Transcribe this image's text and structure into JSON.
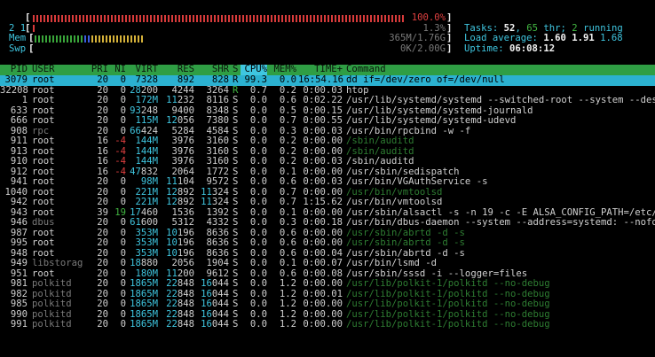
{
  "meters": {
    "cpu1": {
      "label": "1",
      "value": "100.0%",
      "fill": 1.0
    },
    "cpu2": {
      "label": "2",
      "value": "1.3%",
      "fill": 0.013
    },
    "mem": {
      "label": "Mem",
      "value": "365M/1.76G",
      "fill": 0.2
    },
    "swp": {
      "label": "Swp",
      "value": "0K/2.00G",
      "fill": 0.0
    }
  },
  "summary": {
    "tasks_label": "Tasks:",
    "tasks": "52",
    "sep": ",",
    "thr": "65",
    "thr_label": "thr;",
    "running": "2",
    "running_label": "running",
    "load_label": "Load average:",
    "load1": "1.60",
    "load5": "1.91",
    "load15": "1.68",
    "uptime_label": "Uptime:",
    "uptime": "06:08:12"
  },
  "columns": [
    "PID",
    "USER",
    "PRI",
    "NI",
    "VIRT",
    "RES",
    "SHR",
    "S",
    "CPU%",
    "MEM%",
    "TIME+",
    "Command"
  ],
  "colors": {
    "header_bg": "#2f9e44",
    "selected_bg": "#2bb1d0",
    "sort_bg": "#3fc6e0"
  },
  "processes": [
    {
      "pid": "3079",
      "user": "root",
      "pri": "20",
      "ni": "0",
      "virt": "7328",
      "res": "892",
      "shr": "828",
      "s": "R",
      "cpu": "99.3",
      "mem": "0.0",
      "time": "16:54.16",
      "cmd": "dd if=/dev/zero of=/dev/null",
      "selected": true
    },
    {
      "pid": "32208",
      "user": "root",
      "pri": "20",
      "ni": "0",
      "virt": "28200",
      "res": "4244",
      "shr": "3264",
      "s": "R",
      "cpu": "0.7",
      "mem": "0.2",
      "time": "0:00.03",
      "cmd": "htop"
    },
    {
      "pid": "1",
      "user": "root",
      "pri": "20",
      "ni": "0",
      "virt": "172M",
      "res": "11232",
      "shr": "8116",
      "s": "S",
      "cpu": "0.0",
      "mem": "0.6",
      "time": "0:02.22",
      "cmd": "/usr/lib/systemd/systemd --switched-root --system --deseri"
    },
    {
      "pid": "633",
      "user": "root",
      "pri": "20",
      "ni": "0",
      "virt": "93248",
      "res": "9400",
      "shr": "8348",
      "s": "S",
      "cpu": "0.0",
      "mem": "0.5",
      "time": "0:00.15",
      "cmd": "/usr/lib/systemd/systemd-journald"
    },
    {
      "pid": "666",
      "user": "root",
      "pri": "20",
      "ni": "0",
      "virt": "115M",
      "res": "12056",
      "shr": "7380",
      "s": "S",
      "cpu": "0.0",
      "mem": "0.7",
      "time": "0:00.55",
      "cmd": "/usr/lib/systemd/systemd-udevd"
    },
    {
      "pid": "908",
      "user": "rpc",
      "pri": "20",
      "ni": "0",
      "virt": "66424",
      "res": "5284",
      "shr": "4584",
      "s": "S",
      "cpu": "0.0",
      "mem": "0.3",
      "time": "0:00.03",
      "cmd": "/usr/bin/rpcbind -w -f",
      "dimuser": true
    },
    {
      "pid": "911",
      "user": "root",
      "pri": "16",
      "ni": "-4",
      "virt": "144M",
      "res": "3976",
      "shr": "3160",
      "s": "S",
      "cpu": "0.0",
      "mem": "0.2",
      "time": "0:00.00",
      "cmd": "/sbin/auditd",
      "thread": true
    },
    {
      "pid": "913",
      "user": "root",
      "pri": "16",
      "ni": "-4",
      "virt": "144M",
      "res": "3976",
      "shr": "3160",
      "s": "S",
      "cpu": "0.0",
      "mem": "0.2",
      "time": "0:00.00",
      "cmd": "/sbin/auditd",
      "thread": true
    },
    {
      "pid": "910",
      "user": "root",
      "pri": "16",
      "ni": "-4",
      "virt": "144M",
      "res": "3976",
      "shr": "3160",
      "s": "S",
      "cpu": "0.0",
      "mem": "0.2",
      "time": "0:00.03",
      "cmd": "/sbin/auditd"
    },
    {
      "pid": "912",
      "user": "root",
      "pri": "16",
      "ni": "-4",
      "virt": "47832",
      "res": "2064",
      "shr": "1772",
      "s": "S",
      "cpu": "0.0",
      "mem": "0.1",
      "time": "0:00.00",
      "cmd": "/usr/sbin/sedispatch"
    },
    {
      "pid": "941",
      "user": "root",
      "pri": "20",
      "ni": "0",
      "virt": "98M",
      "res": "11104",
      "shr": "9572",
      "s": "S",
      "cpu": "0.0",
      "mem": "0.6",
      "time": "0:00.03",
      "cmd": "/usr/bin/VGAuthService -s"
    },
    {
      "pid": "1040",
      "user": "root",
      "pri": "20",
      "ni": "0",
      "virt": "221M",
      "res": "12892",
      "shr": "11324",
      "s": "S",
      "cpu": "0.0",
      "mem": "0.7",
      "time": "0:00.00",
      "cmd": "/usr/bin/vmtoolsd",
      "thread": true
    },
    {
      "pid": "942",
      "user": "root",
      "pri": "20",
      "ni": "0",
      "virt": "221M",
      "res": "12892",
      "shr": "11324",
      "s": "S",
      "cpu": "0.0",
      "mem": "0.7",
      "time": "1:15.62",
      "cmd": "/usr/bin/vmtoolsd"
    },
    {
      "pid": "943",
      "user": "root",
      "pri": "39",
      "ni": "19",
      "virt": "17460",
      "res": "1536",
      "shr": "1392",
      "s": "S",
      "cpu": "0.0",
      "mem": "0.1",
      "time": "0:00.00",
      "cmd": "/usr/sbin/alsactl -s -n 19 -c -E ALSA_CONFIG_PATH=/etc/als"
    },
    {
      "pid": "946",
      "user": "dbus",
      "pri": "20",
      "ni": "0",
      "virt": "61600",
      "res": "5312",
      "shr": "4332",
      "s": "S",
      "cpu": "0.0",
      "mem": "0.3",
      "time": "0:00.18",
      "cmd": "/usr/bin/dbus-daemon --system --address=systemd: --nofork",
      "dimuser": true
    },
    {
      "pid": "987",
      "user": "root",
      "pri": "20",
      "ni": "0",
      "virt": "353M",
      "res": "10196",
      "shr": "8636",
      "s": "S",
      "cpu": "0.0",
      "mem": "0.6",
      "time": "0:00.00",
      "cmd": "/usr/sbin/abrtd -d -s",
      "thread": true
    },
    {
      "pid": "995",
      "user": "root",
      "pri": "20",
      "ni": "0",
      "virt": "353M",
      "res": "10196",
      "shr": "8636",
      "s": "S",
      "cpu": "0.0",
      "mem": "0.6",
      "time": "0:00.00",
      "cmd": "/usr/sbin/abrtd -d -s",
      "thread": true
    },
    {
      "pid": "948",
      "user": "root",
      "pri": "20",
      "ni": "0",
      "virt": "353M",
      "res": "10196",
      "shr": "8636",
      "s": "S",
      "cpu": "0.0",
      "mem": "0.6",
      "time": "0:00.04",
      "cmd": "/usr/sbin/abrtd -d -s"
    },
    {
      "pid": "949",
      "user": "libstorag",
      "pri": "20",
      "ni": "0",
      "virt": "18880",
      "res": "2056",
      "shr": "1904",
      "s": "S",
      "cpu": "0.0",
      "mem": "0.1",
      "time": "0:00.07",
      "cmd": "/usr/bin/lsmd -d",
      "dimuser": true
    },
    {
      "pid": "951",
      "user": "root",
      "pri": "20",
      "ni": "0",
      "virt": "180M",
      "res": "11200",
      "shr": "9612",
      "s": "S",
      "cpu": "0.0",
      "mem": "0.6",
      "time": "0:00.08",
      "cmd": "/usr/sbin/sssd -i --logger=files"
    },
    {
      "pid": "981",
      "user": "polkitd",
      "pri": "20",
      "ni": "0",
      "virt": "1865M",
      "res": "22848",
      "shr": "16044",
      "s": "S",
      "cpu": "0.0",
      "mem": "1.2",
      "time": "0:00.00",
      "cmd": "/usr/lib/polkit-1/polkitd --no-debug",
      "thread": true,
      "dimuser": true
    },
    {
      "pid": "982",
      "user": "polkitd",
      "pri": "20",
      "ni": "0",
      "virt": "1865M",
      "res": "22848",
      "shr": "16044",
      "s": "S",
      "cpu": "0.0",
      "mem": "1.2",
      "time": "0:00.01",
      "cmd": "/usr/lib/polkit-1/polkitd --no-debug",
      "thread": true,
      "dimuser": true
    },
    {
      "pid": "985",
      "user": "polkitd",
      "pri": "20",
      "ni": "0",
      "virt": "1865M",
      "res": "22848",
      "shr": "16044",
      "s": "S",
      "cpu": "0.0",
      "mem": "1.2",
      "time": "0:00.00",
      "cmd": "/usr/lib/polkit-1/polkitd --no-debug",
      "thread": true,
      "dimuser": true
    },
    {
      "pid": "990",
      "user": "polkitd",
      "pri": "20",
      "ni": "0",
      "virt": "1865M",
      "res": "22848",
      "shr": "16044",
      "s": "S",
      "cpu": "0.0",
      "mem": "1.2",
      "time": "0:00.00",
      "cmd": "/usr/lib/polkit-1/polkitd --no-debug",
      "thread": true,
      "dimuser": true
    },
    {
      "pid": "991",
      "user": "polkitd",
      "pri": "20",
      "ni": "0",
      "virt": "1865M",
      "res": "22848",
      "shr": "16044",
      "s": "S",
      "cpu": "0.0",
      "mem": "1.2",
      "time": "0:00.00",
      "cmd": "/usr/lib/polkit-1/polkitd --no-debug",
      "thread": true,
      "dimuser": true
    }
  ]
}
